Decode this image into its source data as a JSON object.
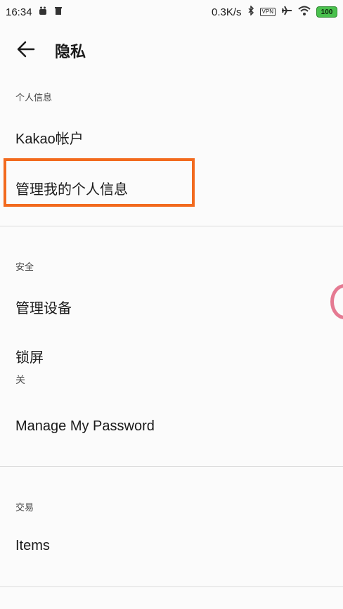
{
  "status": {
    "time": "16:34",
    "speed": "0.3K/s",
    "vpn": "VPN",
    "battery": "100",
    "icons": [
      "android-icon",
      "trash-icon",
      "bluetooth-icon",
      "airplane-icon",
      "wifi-icon",
      "battery-icon"
    ]
  },
  "header": {
    "title": "隐私"
  },
  "sections": {
    "personal": {
      "label": "个人信息",
      "items": [
        "Kakao帐户",
        "管理我的个人信息"
      ]
    },
    "security": {
      "label": "安全",
      "items": [
        "管理设备",
        "锁屏",
        "Manage My Password"
      ],
      "lock_screen_value": "关"
    },
    "transaction": {
      "label": "交易",
      "items": [
        "Items"
      ]
    }
  },
  "colors": {
    "highlight": "#f26a1e",
    "divider": "#dcdcdc",
    "battery": "#49c14d"
  }
}
